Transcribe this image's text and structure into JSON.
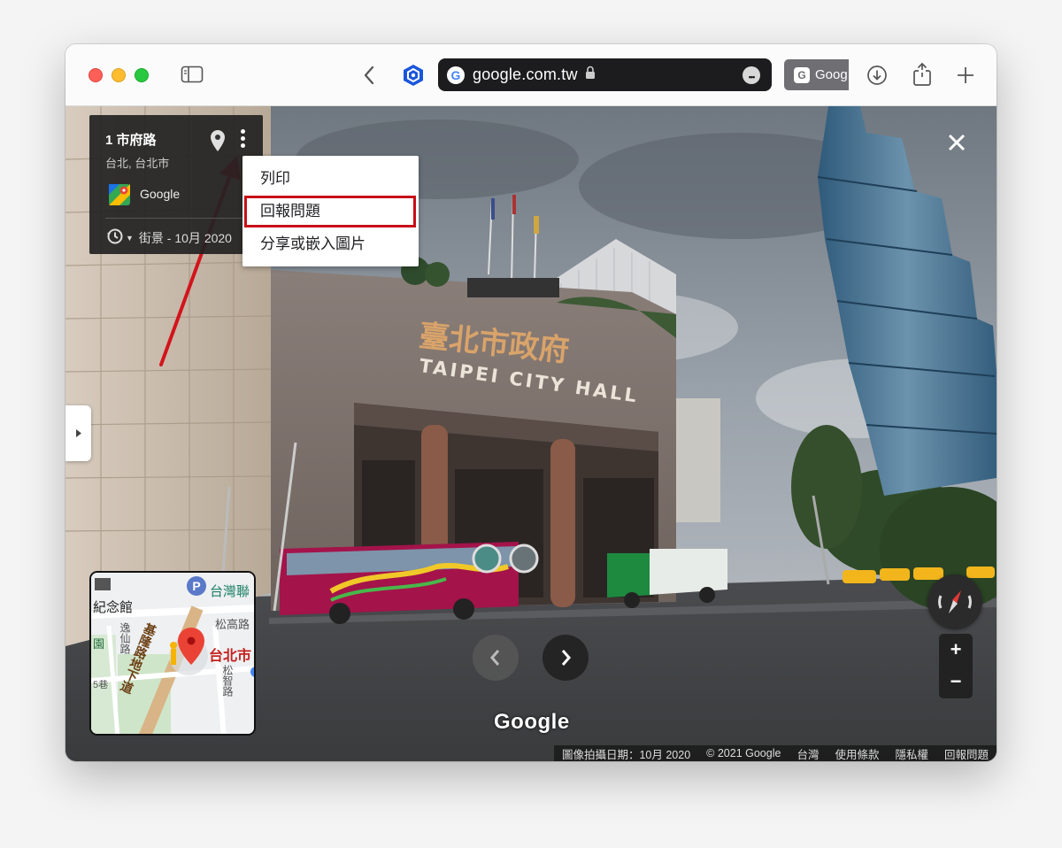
{
  "browser": {
    "url": "google.com.tw",
    "favicon_letter": "G",
    "second_tab_letter": "G",
    "second_tab_label": "Goog",
    "more_glyph": "•••"
  },
  "infocard": {
    "title": "1 市府路",
    "subtitle": "台北, 台北市",
    "source": "Google",
    "history_label": "街景 - 10月 2020"
  },
  "menu": {
    "items": [
      "列印",
      "回報問題",
      "分享或嵌入圖片"
    ]
  },
  "scene": {
    "sign_cn": "臺北市政府",
    "sign_en": "TAIPEI CITY HALL"
  },
  "minimap": {
    "labels": [
      "紀念館",
      "台灣聯",
      "松高路",
      "逸仙路",
      "基隆路地下道",
      "台北市",
      "松智路",
      "園",
      "5巷"
    ],
    "poi_letter": "P"
  },
  "navigation": {
    "prev": "‹",
    "next": "›"
  },
  "zoom": {
    "plus": "+",
    "minus": "−"
  },
  "watermark": "Google",
  "footer": {
    "items": [
      "圖像拍攝日期：10月 2020",
      "© 2021 Google",
      "台灣",
      "使用條款",
      "隱私權",
      "回報問題"
    ]
  },
  "colors": {
    "annotation_red": "#c70f17",
    "arrow_red": "#d3141c",
    "compass_red": "#e53935"
  }
}
